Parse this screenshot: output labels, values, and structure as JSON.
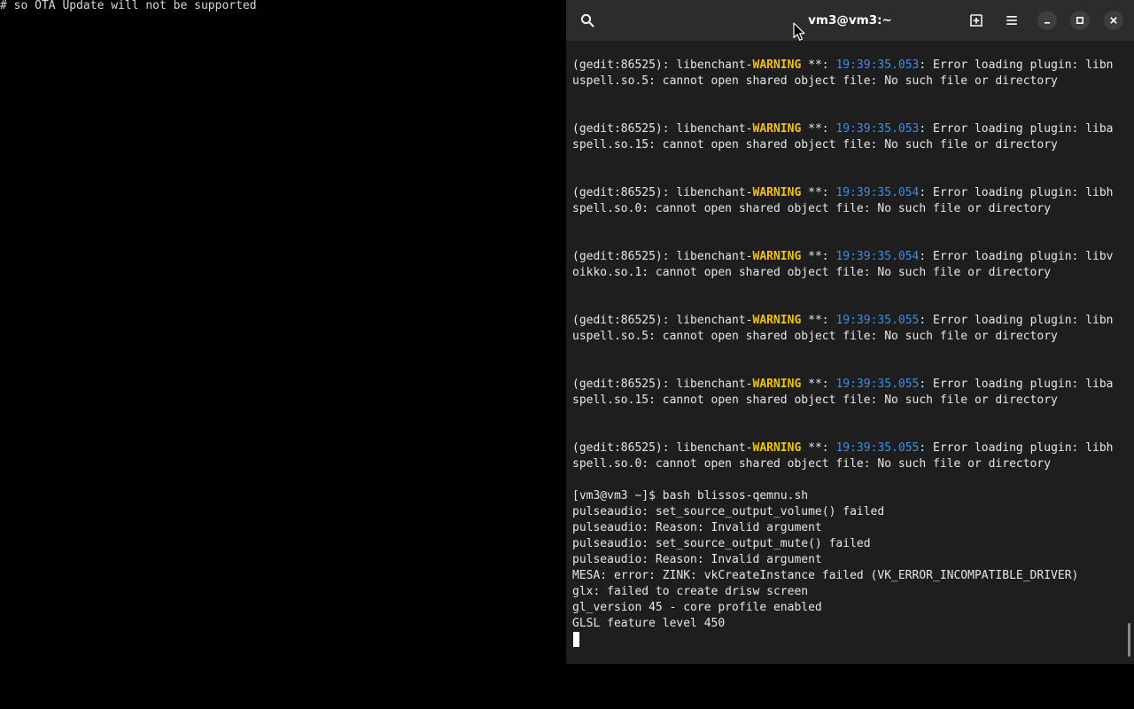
{
  "qemu_console": {
    "text": "# so OTA Update will not be supported"
  },
  "terminal": {
    "title": "vm3@vm3:~",
    "buttons": {
      "search": "search-icon",
      "new_tab": "new-tab-icon",
      "menu": "hamburger-menu-icon",
      "minimize": "minimize-icon",
      "maximize": "maximize-icon",
      "close": "close-icon"
    },
    "colors": {
      "background": "#1e1e1e",
      "headerbar": "#2c2c2c",
      "warning": "#f5c211",
      "timestamp": "#3d8fe3",
      "text": "#e6e6e6"
    },
    "log_entries": [
      {
        "prefix": "(gedit:86525): libenchant-",
        "level": "WARNING",
        "stars": " **: ",
        "time": "19:39:35.053",
        "message": ": Error loading plugin: libn",
        "continuation": "uspell.so.5: cannot open shared object file: No such file or directory"
      },
      {
        "prefix": "(gedit:86525): libenchant-",
        "level": "WARNING",
        "stars": " **: ",
        "time": "19:39:35.053",
        "message": ": Error loading plugin: liba",
        "continuation": "spell.so.15: cannot open shared object file: No such file or directory"
      },
      {
        "prefix": "(gedit:86525): libenchant-",
        "level": "WARNING",
        "stars": " **: ",
        "time": "19:39:35.054",
        "message": ": Error loading plugin: libh",
        "continuation": "spell.so.0: cannot open shared object file: No such file or directory"
      },
      {
        "prefix": "(gedit:86525): libenchant-",
        "level": "WARNING",
        "stars": " **: ",
        "time": "19:39:35.054",
        "message": ": Error loading plugin: libv",
        "continuation": "oikko.so.1: cannot open shared object file: No such file or directory"
      },
      {
        "prefix": "(gedit:86525): libenchant-",
        "level": "WARNING",
        "stars": " **: ",
        "time": "19:39:35.055",
        "message": ": Error loading plugin: libn",
        "continuation": "uspell.so.5: cannot open shared object file: No such file or directory"
      },
      {
        "prefix": "(gedit:86525): libenchant-",
        "level": "WARNING",
        "stars": " **: ",
        "time": "19:39:35.055",
        "message": ": Error loading plugin: liba",
        "continuation": "spell.so.15: cannot open shared object file: No such file or directory"
      },
      {
        "prefix": "(gedit:86525): libenchant-",
        "level": "WARNING",
        "stars": " **: ",
        "time": "19:39:35.055",
        "message": ": Error loading plugin: libh",
        "continuation": "spell.so.0: cannot open shared object file: No such file or directory"
      }
    ],
    "output_lines": [
      "[vm3@vm3 ~]$ bash blissos-qemnu.sh",
      "pulseaudio: set_source_output_volume() failed",
      "pulseaudio: Reason: Invalid argument",
      "pulseaudio: set_source_output_mute() failed",
      "pulseaudio: Reason: Invalid argument",
      "MESA: error: ZINK: vkCreateInstance failed (VK_ERROR_INCOMPATIBLE_DRIVER)",
      "glx: failed to create drisw screen",
      "gl_version 45 - core profile enabled",
      "GLSL feature level 450"
    ]
  }
}
